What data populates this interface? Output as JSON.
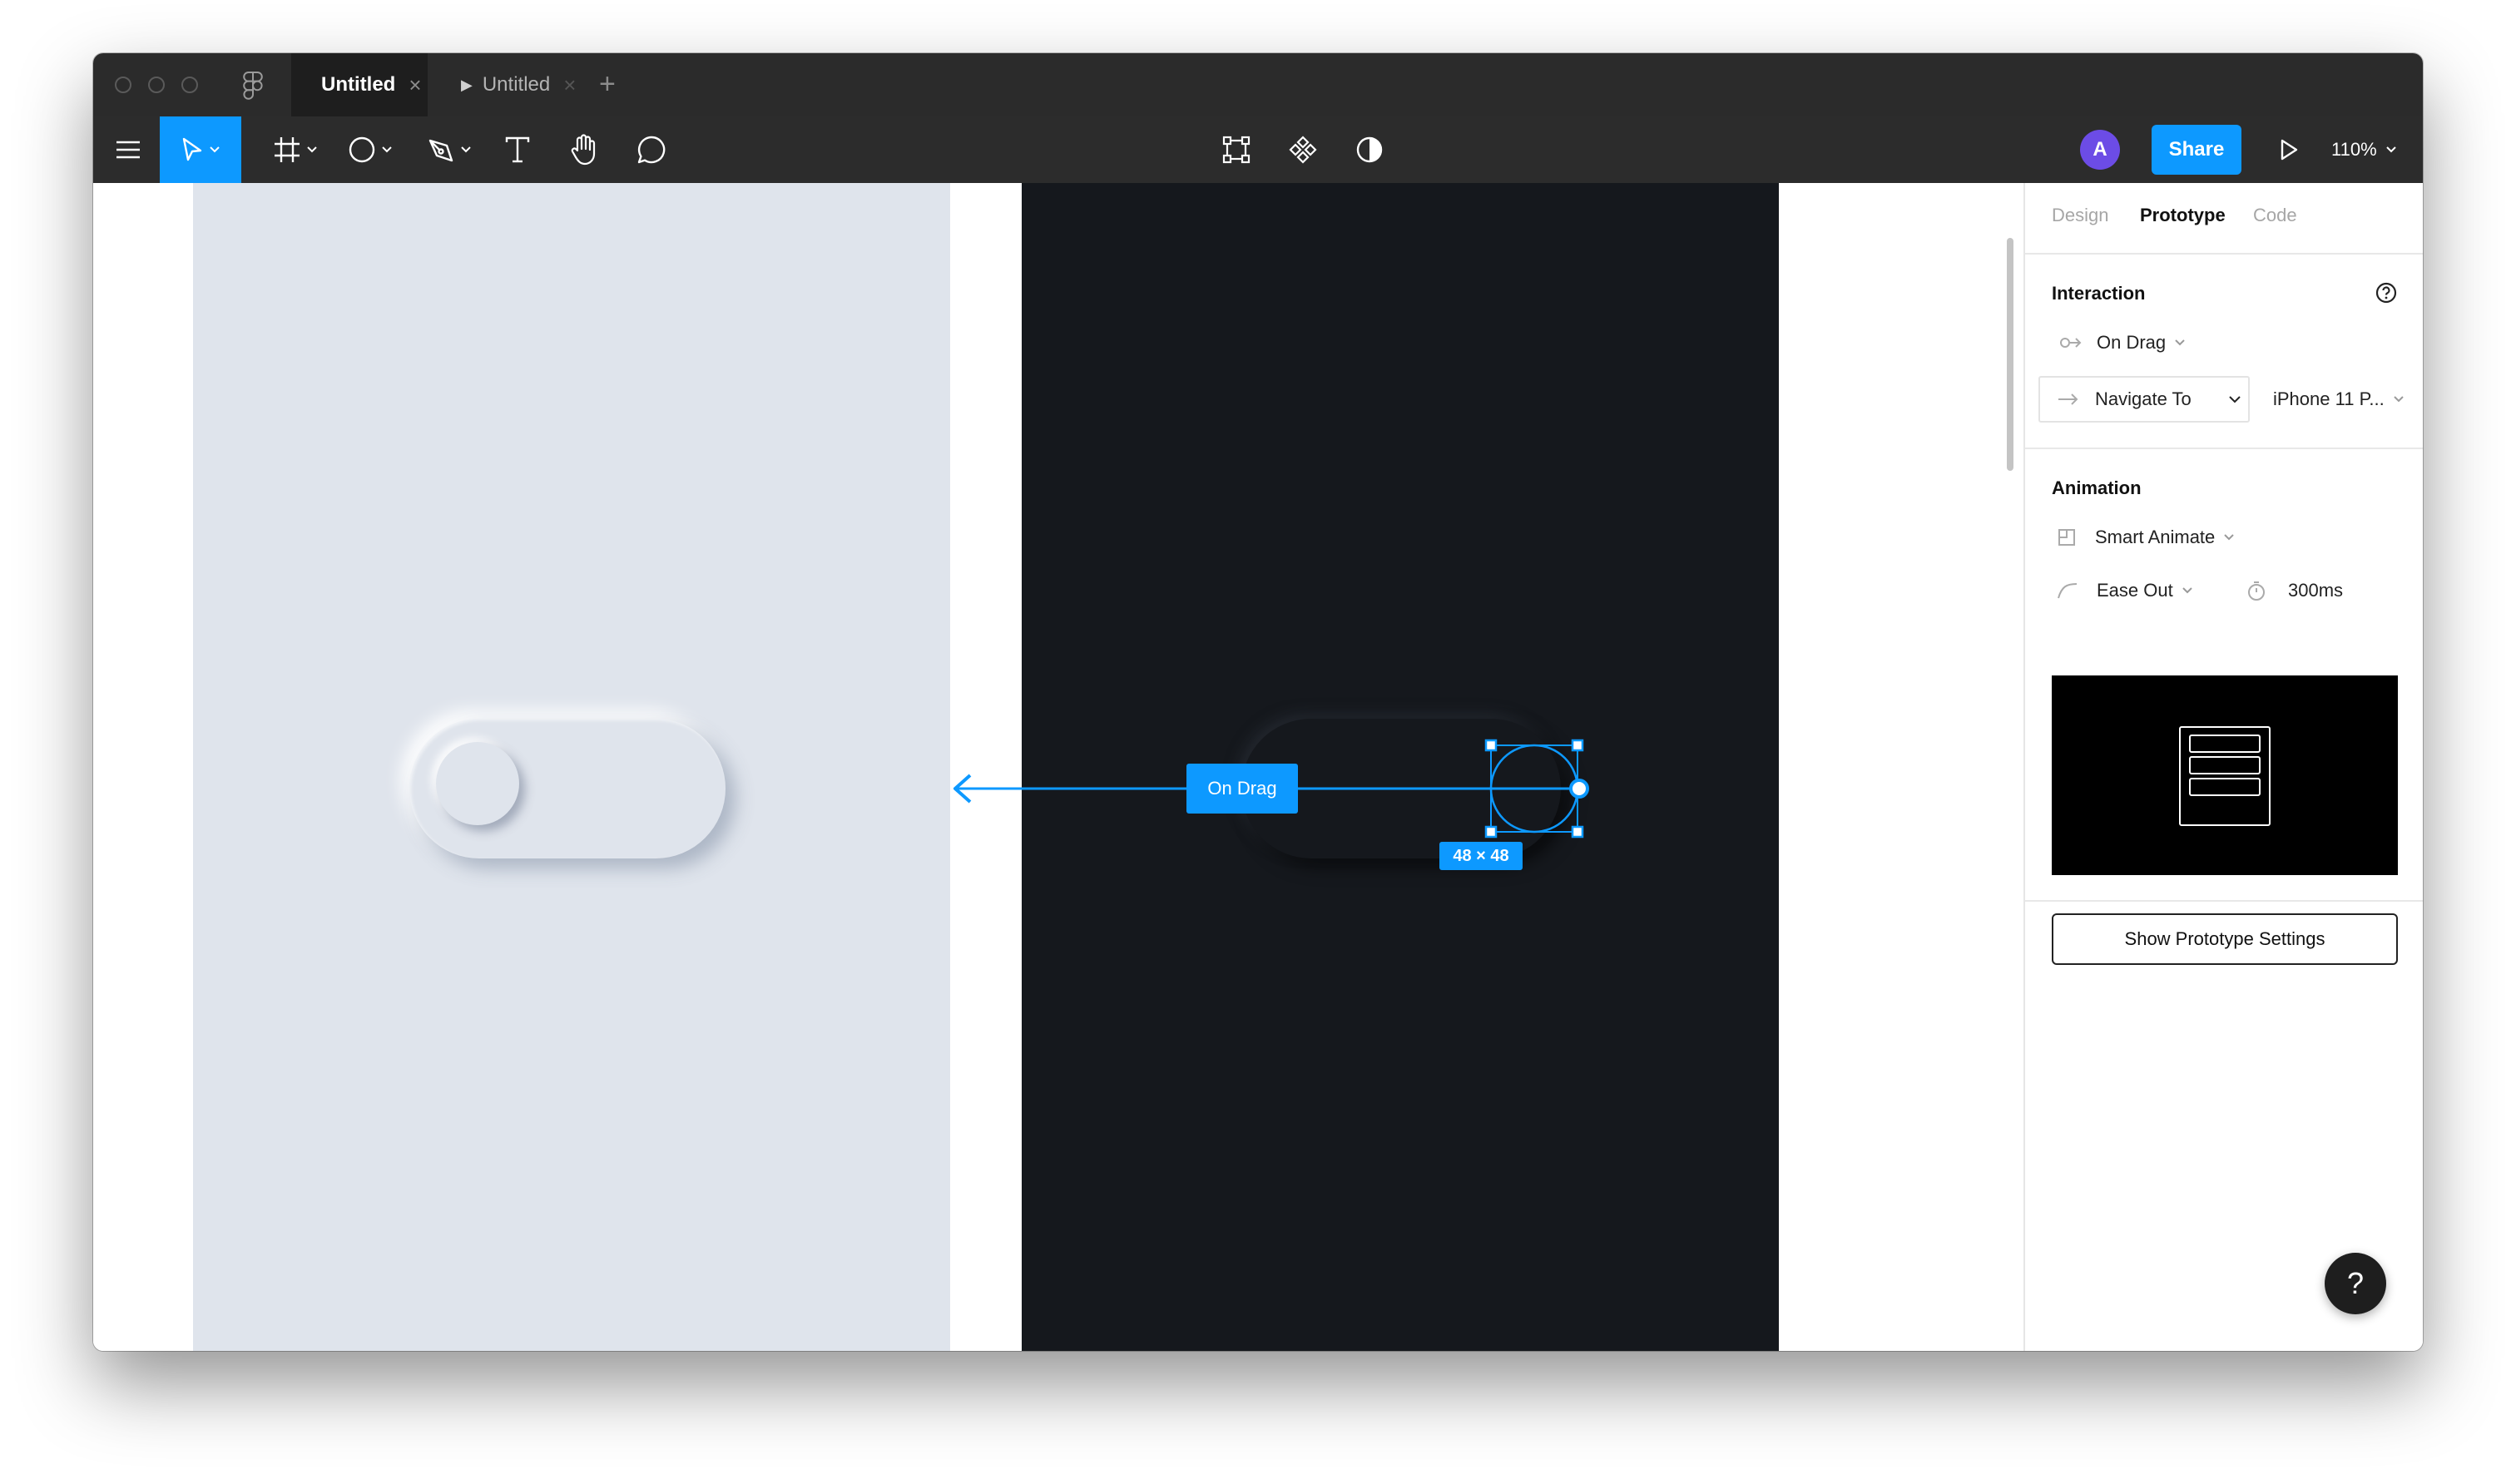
{
  "tabs": [
    {
      "label": "Untitled",
      "close": "×"
    },
    {
      "label": "Untitled",
      "close": "×"
    }
  ],
  "new_tab": "+",
  "toolbar": {
    "avatar_initial": "A",
    "share_label": "Share",
    "zoom": "110%"
  },
  "canvas": {
    "interaction_label": "On Drag",
    "selection_size": "48 × 48"
  },
  "panel": {
    "tabs": [
      "Design",
      "Prototype",
      "Code"
    ],
    "active_tab": "Prototype",
    "interaction": {
      "title": "Interaction",
      "trigger": "On Drag",
      "action": "Navigate To",
      "destination": "iPhone 11 P..."
    },
    "animation": {
      "title": "Animation",
      "type": "Smart Animate",
      "easing": "Ease Out",
      "duration": "300ms"
    },
    "settings_button": "Show Prototype Settings"
  },
  "help_label": "?",
  "colors": {
    "accent": "#0d99ff",
    "titlebar": "#2b2b2b",
    "toolbar": "#2c2c2c",
    "light_frame": "#dfe4ec",
    "dark_frame": "#15181d",
    "avatar": "#6c4ce6"
  },
  "icons": {
    "window_controls": [
      "close-control",
      "minimize-control",
      "zoom-control"
    ],
    "toolbar": [
      "menu-icon",
      "move-tool-icon",
      "frame-tool-icon",
      "ellipse-tool-icon",
      "pen-tool-icon",
      "text-tool-icon",
      "hand-tool-icon",
      "comment-tool-icon",
      "crop-icon",
      "component-icon",
      "contrast-icon",
      "play-icon"
    ]
  }
}
